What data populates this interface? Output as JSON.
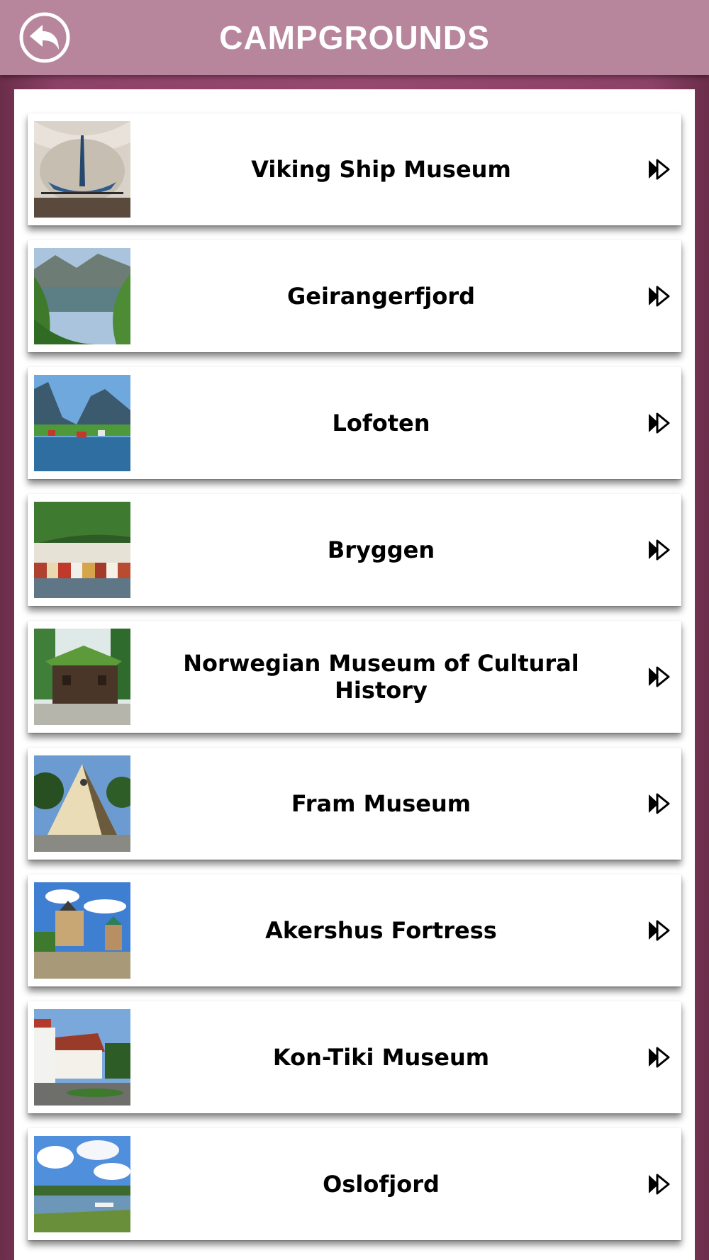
{
  "header": {
    "title": "CAMPGROUNDS",
    "back_icon": "back-arrow-icon"
  },
  "colors": {
    "header_bg": "#b8869c",
    "frame_bg": "#96496f",
    "card_bg": "#ffffff"
  },
  "list": {
    "items": [
      {
        "label": "Viking Ship Museum",
        "thumbnail": "viking-ship-photo"
      },
      {
        "label": "Geirangerfjord",
        "thumbnail": "fjord-photo"
      },
      {
        "label": "Lofoten",
        "thumbnail": "lofoten-photo"
      },
      {
        "label": "Bryggen",
        "thumbnail": "bryggen-photo"
      },
      {
        "label": "Norwegian Museum of Cultural History",
        "thumbnail": "turf-roof-house-photo"
      },
      {
        "label": "Fram Museum",
        "thumbnail": "fram-museum-photo"
      },
      {
        "label": "Akershus Fortress",
        "thumbnail": "fortress-photo"
      },
      {
        "label": "Kon-Tiki Museum",
        "thumbnail": "kon-tiki-museum-photo"
      },
      {
        "label": "Oslofjord",
        "thumbnail": "oslofjord-photo"
      }
    ],
    "item_icon": "double-chevron-right-icon"
  }
}
